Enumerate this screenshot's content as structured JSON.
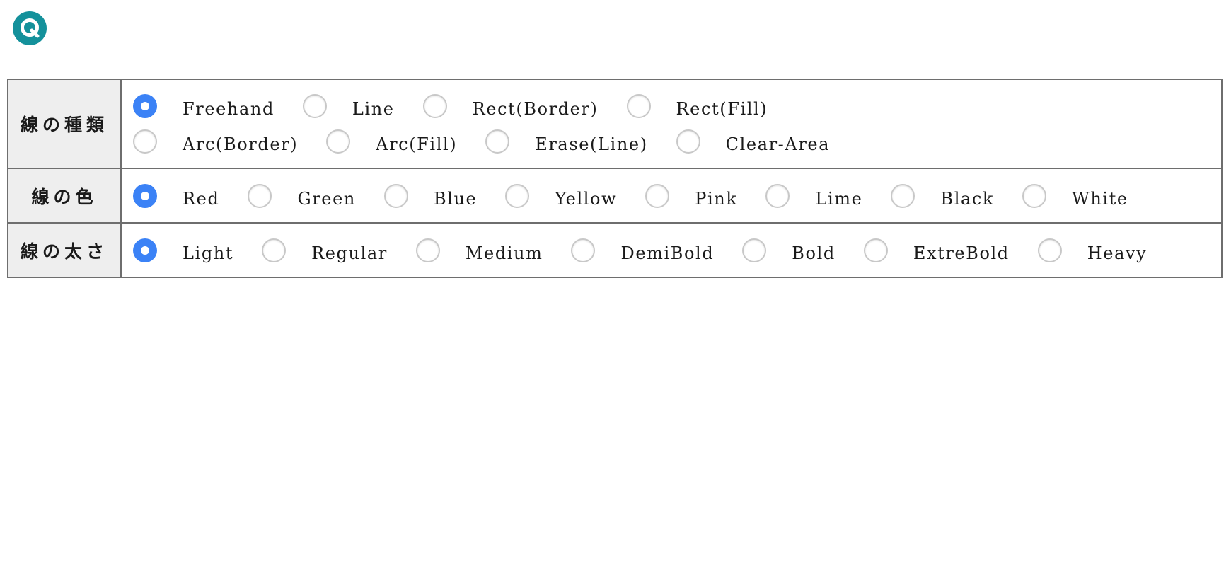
{
  "header": {
    "logo_icon": "q-icon",
    "logo_color": "#14919b"
  },
  "colors": {
    "radio_selected": "#3b82f6",
    "header_cell_bg": "#eeeeee",
    "border": "#6e6e6e"
  },
  "settings": {
    "line_type": {
      "label": "線の種類",
      "options_row1": [
        "Freehand",
        "Line",
        "Rect(Border)",
        "Rect(Fill)"
      ],
      "options_row2": [
        "Arc(Border)",
        "Arc(Fill)",
        "Erase(Line)",
        "Clear-Area"
      ],
      "selected": "Freehand"
    },
    "line_color": {
      "label": "線の色",
      "options": [
        "Red",
        "Green",
        "Blue",
        "Yellow",
        "Pink",
        "Lime",
        "Black",
        "White"
      ],
      "selected": "Red"
    },
    "line_width": {
      "label": "線の太さ",
      "options": [
        "Light",
        "Regular",
        "Medium",
        "DemiBold",
        "Bold",
        "ExtreBold",
        "Heavy"
      ],
      "selected": "Light"
    }
  }
}
